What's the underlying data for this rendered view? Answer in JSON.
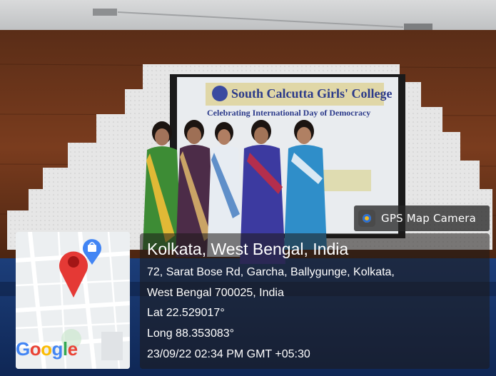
{
  "photo": {
    "screen_title": "South Calcutta Girls' College",
    "screen_subtitle": "Celebrating International Day of Democracy"
  },
  "badge": {
    "label": "GPS Map Camera",
    "icon": "camera-icon"
  },
  "location": {
    "city": "Kolkata, West Bengal, India",
    "address_line1": "72, Sarat Bose Rd, Garcha, Ballygunge, Kolkata,",
    "address_line2": "West Bengal 700025, India",
    "lat": "Lat 22.529017°",
    "long": "Long 88.353083°",
    "timestamp": "23/09/22 02:34 PM GMT +05:30"
  },
  "map": {
    "brand": "Google",
    "pin_icon": "map-pin-icon",
    "shop_icon": "shopping-bag-icon"
  },
  "colors": {
    "pin": "#e53935",
    "shop_pin": "#4285f4",
    "overlay": "#1e1a18"
  }
}
